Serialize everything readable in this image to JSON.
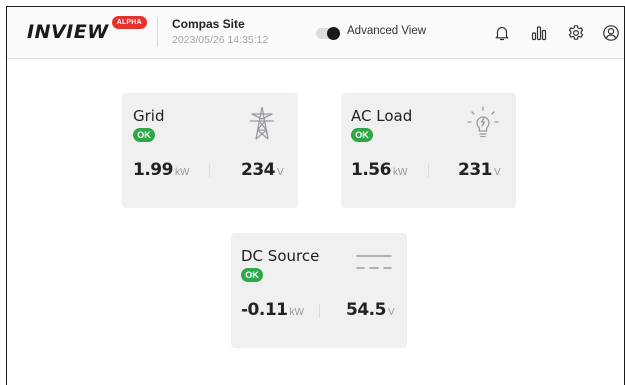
{
  "header": {
    "logo_text": "INVIEW",
    "logo_badge": "ALPHA",
    "site_name": "Compas Site",
    "timestamp": "2023/05/26 14:35:12",
    "advanced_view_label": "Advanced View",
    "advanced_view_on": false,
    "icons": [
      "bell-icon",
      "chart-icon",
      "settings-icon",
      "user-icon"
    ]
  },
  "cards": {
    "grid": {
      "title": "Grid",
      "status": "OK",
      "power_value": "1.99",
      "power_unit": "kW",
      "voltage_value": "234",
      "voltage_unit": "V",
      "icon": "transmission-tower-icon"
    },
    "ac_load": {
      "title": "AC Load",
      "status": "OK",
      "power_value": "1.56",
      "power_unit": "kW",
      "voltage_value": "231",
      "voltage_unit": "V",
      "icon": "lightbulb-icon"
    },
    "dc_source": {
      "title": "DC Source",
      "status": "OK",
      "power_value": "-0.11",
      "power_unit": "kW",
      "voltage_value": "54.5",
      "voltage_unit": "V",
      "icon": "dc-symbol-icon"
    }
  },
  "colors": {
    "ok_green": "#2fa84a",
    "badge_red": "#e5322d",
    "card_bg": "#f0f0f0",
    "icon_gray": "#9a9aa5"
  }
}
